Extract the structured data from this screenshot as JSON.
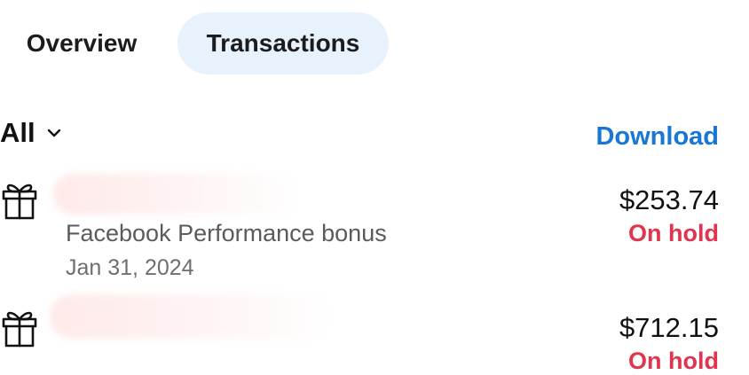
{
  "tabs": {
    "overview": "Overview",
    "transactions": "Transactions"
  },
  "filter": {
    "label": "All",
    "icon": "chevron-down-icon"
  },
  "download_label": "Download",
  "transactions": [
    {
      "icon": "gift-icon",
      "name": "",
      "description": "Facebook Performance bonus",
      "date": "Jan 31, 2024",
      "amount": "$253.74",
      "status": "On hold"
    },
    {
      "icon": "gift-icon",
      "name": "",
      "amount": "$712.15",
      "status": "On hold"
    }
  ],
  "colors": {
    "accent": "#1877d4",
    "status_on_hold": "#e0344f",
    "active_tab_bg": "#e8f2fc"
  }
}
